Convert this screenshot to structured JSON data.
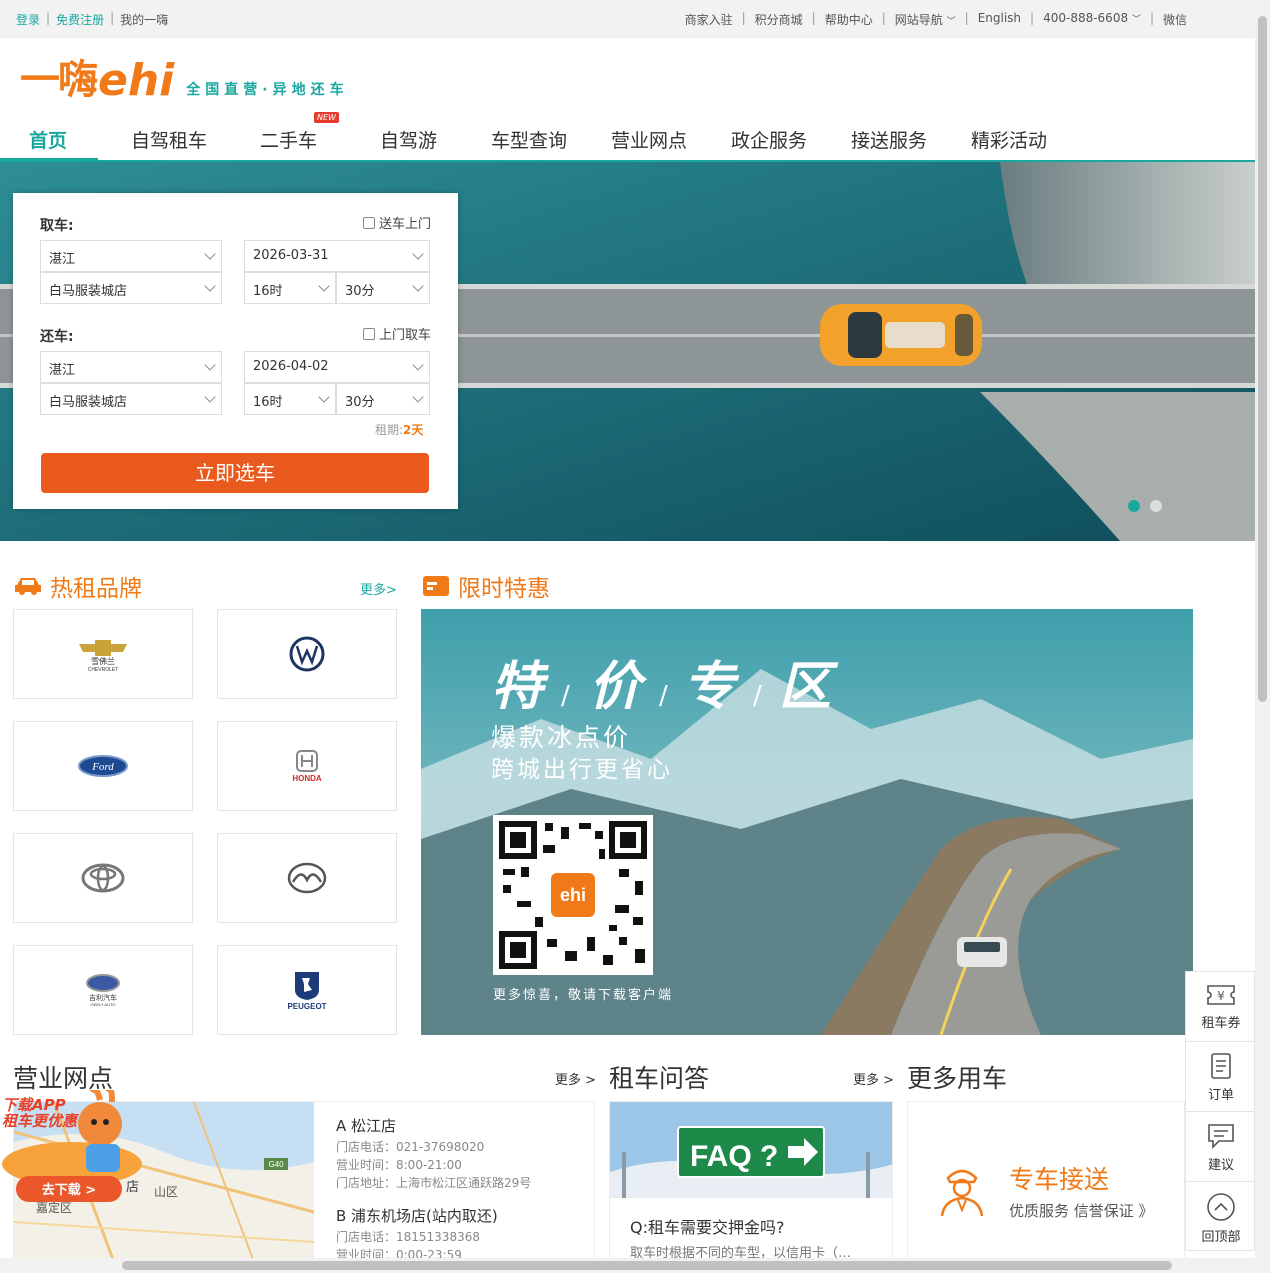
{
  "topbar": {
    "login": "登录",
    "register": "免费注册",
    "my_ehi": "我的一嗨",
    "merchant": "商家入驻",
    "points_mall": "积分商城",
    "help": "帮助中心",
    "site_nav": "网站导航",
    "english": "English",
    "phone": "400-888-6608",
    "wechat": "微信",
    "separator": "|"
  },
  "logo": {
    "cn": "一嗨",
    "en": "ehi",
    "slogan": "全国直营·异地还车"
  },
  "nav": {
    "items": [
      "首页",
      "自驾租车",
      "二手车",
      "自驾游",
      "车型查询",
      "营业网点",
      "政企服务",
      "接送服务",
      "精彩活动"
    ],
    "new_badge": "NEW"
  },
  "search": {
    "pickup_label": "取车:",
    "pickup_delivery": "送车上门",
    "pickup_city": "湛江",
    "pickup_store": "白马服装城店",
    "pickup_date": "2026-03-31",
    "pickup_hour": "16时",
    "pickup_minute": "30分",
    "return_label": "还车:",
    "return_collect": "上门取车",
    "return_city": "湛江",
    "return_store": "白马服装城店",
    "return_date": "2026-04-02",
    "return_hour": "16时",
    "return_minute": "30分",
    "rent_period_label": "租期:",
    "rent_period_value": "2天",
    "submit": "立即选车"
  },
  "brands": {
    "title": "热租品牌",
    "more": "更多>",
    "items": [
      {
        "name": "雪佛兰",
        "sub": "CHEVROLET"
      },
      {
        "name": "VW"
      },
      {
        "name": "Ford"
      },
      {
        "name": "HONDA"
      },
      {
        "name": "TOYOTA"
      },
      {
        "name": "MAZDA"
      },
      {
        "name": "吉利汽车",
        "sub": "GEELY AUTO"
      },
      {
        "name": "PEUGEOT"
      }
    ]
  },
  "promo": {
    "title": "限时特惠",
    "headline_chars": [
      "特",
      "价",
      "专",
      "区"
    ],
    "line1": "爆款冰点价",
    "line2": "跨城出行更省心",
    "qr_logo": "ehi",
    "footer": "更多惊喜，敬请下载客户端"
  },
  "stores": {
    "title": "营业网点",
    "more": "更多 >",
    "map_labels": [
      "G40",
      "店",
      "山区",
      "嘉定区"
    ],
    "list": [
      {
        "name": "A 松江店",
        "phone": "门店电话：021-37698020",
        "hours": "营业时间：8:00-21:00",
        "address": "门店地址：上海市松江区通跃路29号"
      },
      {
        "name": "B 浦东机场店(站内取还)",
        "phone": "门店电话：18151338368",
        "hours": "营业时间：0:00-23:59"
      }
    ]
  },
  "faq": {
    "title": "租车问答",
    "more": "更多 >",
    "sign": "FAQ ?",
    "question": "Q:租车需要交押金吗?",
    "answer": "取车时根据不同的车型，以信用卡（…"
  },
  "more_use": {
    "title": "更多用车",
    "service": "专车接送",
    "desc": "优质服务 信誉保证 》"
  },
  "float_bar": {
    "coupon": "租车券",
    "order": "订单",
    "suggest": "建议",
    "top": "回顶部"
  },
  "app_ad": {
    "line1": "下载APP",
    "line2": "租车更优惠",
    "button": "去下载 >"
  },
  "colors": {
    "brand_orange": "#f07a18",
    "teal": "#19a8a0",
    "button_orange": "#ea5a1f"
  }
}
